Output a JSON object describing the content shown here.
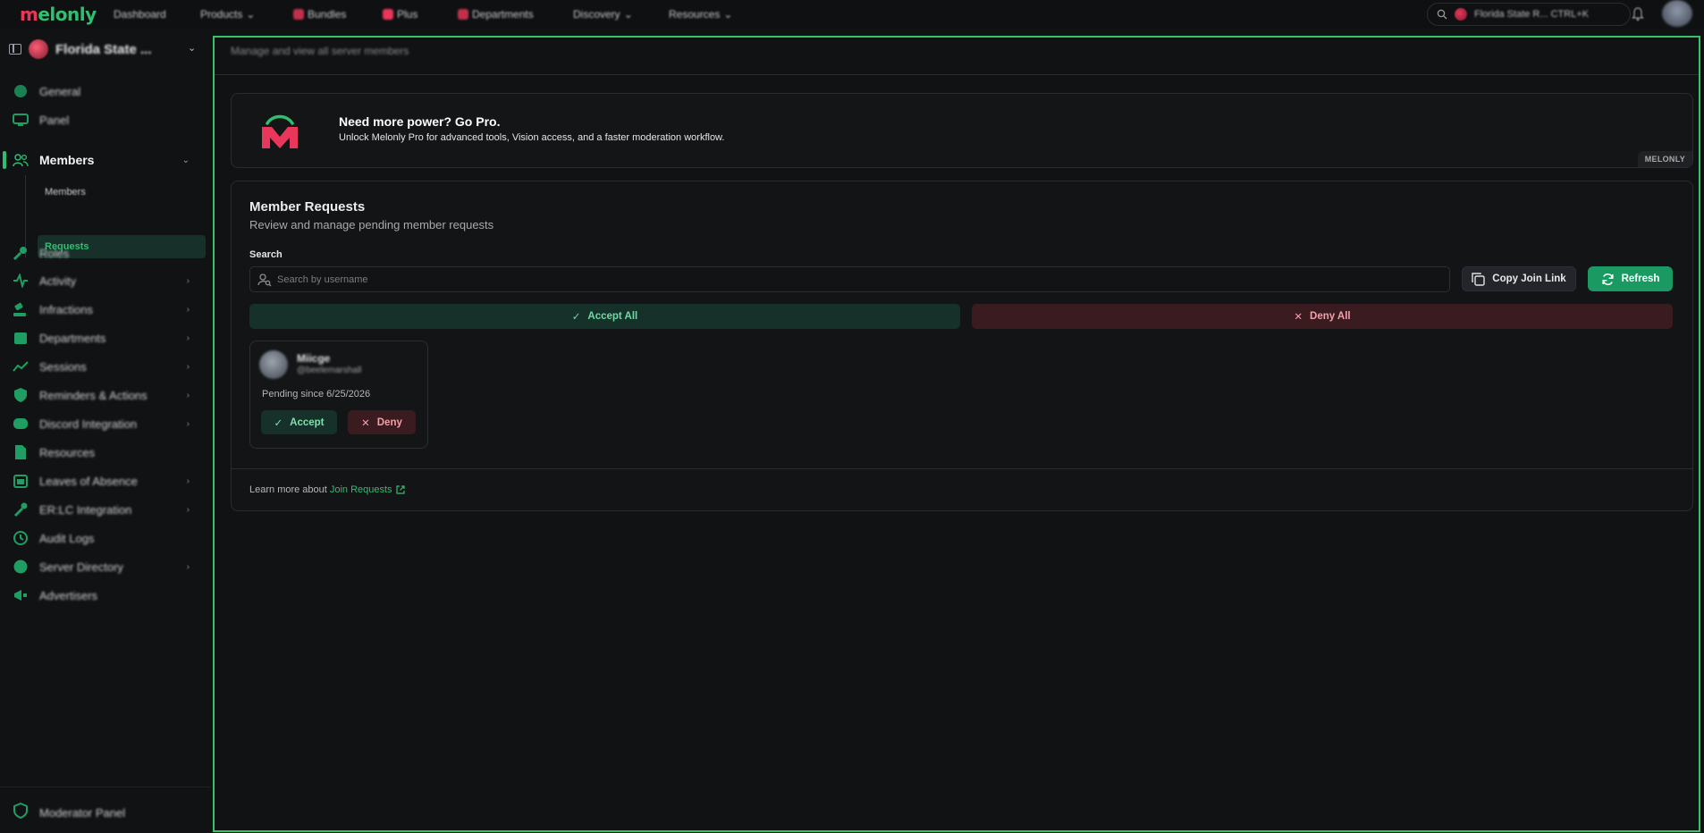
{
  "topbar": {
    "logo": "melonly",
    "nav": [
      "Dashboard",
      "Products",
      "Bundles",
      "Plus",
      "Departments",
      "Discovery",
      "Resources"
    ],
    "search_text": "Florida State R...  CTRL+K"
  },
  "sidebar": {
    "server_name": "Florida State ...",
    "items": [
      {
        "label": "General"
      },
      {
        "label": "Panel"
      },
      {
        "label": "Members"
      },
      {
        "label": "Roles"
      },
      {
        "label": "Activity"
      },
      {
        "label": "Infractions"
      },
      {
        "label": "Departments"
      },
      {
        "label": "Sessions"
      },
      {
        "label": "Reminders & Actions"
      },
      {
        "label": "Discord Integration"
      },
      {
        "label": "Resources"
      },
      {
        "label": "Leaves of Absence"
      },
      {
        "label": "ER:LC Integration"
      },
      {
        "label": "Audit Logs"
      },
      {
        "label": "Server Directory"
      },
      {
        "label": "Advertisers"
      }
    ],
    "sub_items": {
      "members": "Members",
      "requests": "Requests"
    },
    "moderator_panel": "Moderator Panel"
  },
  "main": {
    "subtitle": "Manage and view all server members"
  },
  "promo": {
    "title": "Need more power? Go Pro.",
    "text": "Unlock Melonly Pro for advanced tools, Vision access, and a faster moderation workflow.",
    "badge": "MELONLY"
  },
  "requests": {
    "title": "Member Requests",
    "subtitle": "Review and manage pending member requests",
    "search_label": "Search",
    "search_placeholder": "Search by username",
    "copy_link": "Copy Join Link",
    "refresh": "Refresh",
    "accept_all": "Accept All",
    "deny_all": "Deny All",
    "list": [
      {
        "name": "Miicge",
        "handle": "@beelemarshall",
        "pending": "Pending since 6/25/2026",
        "accept": "Accept",
        "deny": "Deny"
      }
    ],
    "learn_prefix": "Learn more about",
    "learn_link": "Join Requests"
  },
  "colors": {
    "accent": "#2fbf71",
    "brand_red": "#e8375a",
    "deny": "#f3a0a8",
    "background": "#111214"
  }
}
